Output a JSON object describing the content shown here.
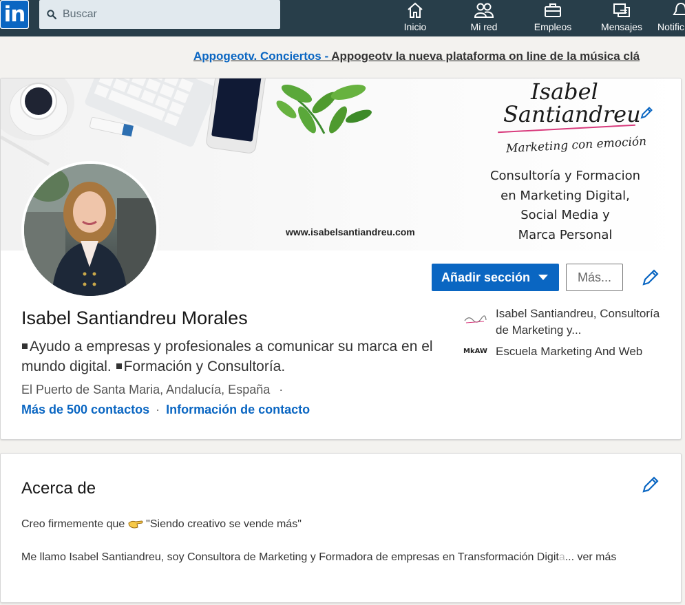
{
  "nav": {
    "logo_text": "in",
    "search_placeholder": "Buscar",
    "items": [
      {
        "label": "Inicio",
        "icon": "home-icon"
      },
      {
        "label": "Mi red",
        "icon": "network-icon"
      },
      {
        "label": "Empleos",
        "icon": "briefcase-icon"
      },
      {
        "label": "Mensajes",
        "icon": "messages-icon"
      },
      {
        "label": "Notific",
        "icon": "bell-icon"
      }
    ]
  },
  "ad": {
    "link_text": "Appogeotv. Conciertos - ",
    "tail_text": "Appogeotv la nueva plataforma on line de la música clá"
  },
  "banner": {
    "brand_line1": "Isabel",
    "brand_line2": "Santiandreu",
    "tagline": "Marketing con emoción",
    "services": [
      "Consultoría y Formacion",
      "en Marketing Digital,",
      "Social Media y",
      "Marca Personal"
    ],
    "website": "www.isabelsantiandreu.com"
  },
  "profile": {
    "name": "Isabel Santiandreu Morales",
    "headline_part1": "Ayudo a empresas y profesionales a comunicar su marca en el mundo digital. ",
    "headline_part2": "Formación y Consultoría.",
    "location": "El Puerto de Santa Maria, Andalucía, España",
    "location_sep": "·",
    "contacts": "Más de 500 contactos",
    "contact_info": "Información de contacto",
    "links_sep": "·",
    "add_section_label": "Añadir sección",
    "more_label": "Más...",
    "companies": [
      {
        "name": "Isabel Santiandreu, Consultoría de Marketing y...",
        "logo": "isabel-santiandreu-logo"
      },
      {
        "name": "Escuela Marketing And Web",
        "logo": "mkaw-logo",
        "logo_text": "MkAW"
      }
    ]
  },
  "about": {
    "title": "Acerca de",
    "line1_before": "Creo firmemente que ",
    "line1_after": " \"Siendo creativo se vende más\"",
    "line2": "Me llamo Isabel Santiandreu, soy Consultora de Marketing y Formadora de empresas en Transformación Digit",
    "line2_fade": "a",
    "line2_more": "... ver más"
  },
  "colors": {
    "nav_bg": "#283e4a",
    "primary": "#0a66c2",
    "page_bg": "#f3f2ef"
  }
}
